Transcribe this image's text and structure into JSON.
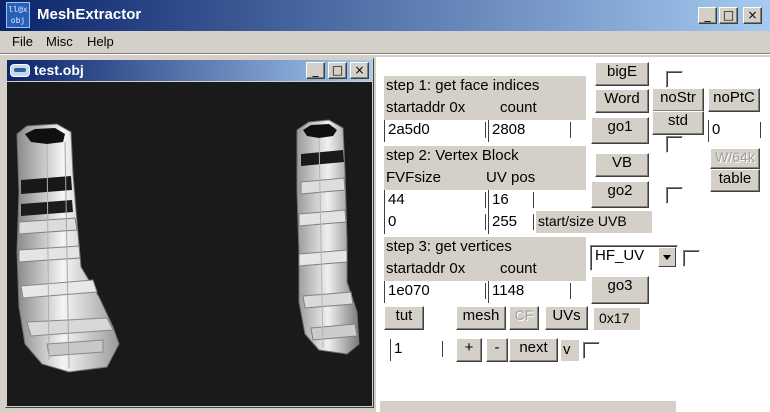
{
  "app": {
    "title": "MeshExtractor",
    "icon_label": "ll@x obj"
  },
  "window_controls": {
    "minimize": "_",
    "maximize": "□",
    "close": "×"
  },
  "menu": [
    {
      "label": "File"
    },
    {
      "label": "Misc"
    },
    {
      "label": "Help"
    }
  ],
  "child_window": {
    "title": "test.obj",
    "viewport_background": "#1a1a1a"
  },
  "step1": {
    "title": "step 1: get face indices",
    "startaddr_label": "startaddr 0x",
    "count_label": "count",
    "startaddr_value": "2a5d0",
    "count_value": "2808"
  },
  "step2": {
    "title": "step 2: Vertex Block",
    "fvfsize_label": "FVFsize",
    "uvpos_label": "UV pos",
    "fvfsize_value": "44",
    "uvpos_value": "16",
    "start_value": "0",
    "size_value": "255",
    "startsize_label": "start/size UVB"
  },
  "step3": {
    "title": "step 3: get vertices",
    "startaddr_label": "startaddr 0x",
    "count_label": "count",
    "startaddr_value": "1e070",
    "count_value": "1148",
    "uv_format": "HF_UV"
  },
  "buttons": {
    "bigE": "bigE",
    "word": "Word",
    "go1": "go1",
    "vb": "VB",
    "go2": "go2",
    "go3": "go3",
    "nostr": "noStr",
    "std": "std",
    "noptc": "noPtC",
    "w64k": "W/64k",
    "table": "table",
    "tut": "tut",
    "mesh": "mesh",
    "cf": "CF",
    "uvs": "UVs",
    "plus": "+",
    "minus": "-",
    "next": "next"
  },
  "labels": {
    "hex_value": "0x17",
    "v": "v"
  },
  "fields": {
    "noptc_value": "0",
    "page_value": "1"
  },
  "colors": {
    "titlebar_start": "#0a246a",
    "titlebar_end": "#a6caf0",
    "face": "#d4d0c8"
  }
}
